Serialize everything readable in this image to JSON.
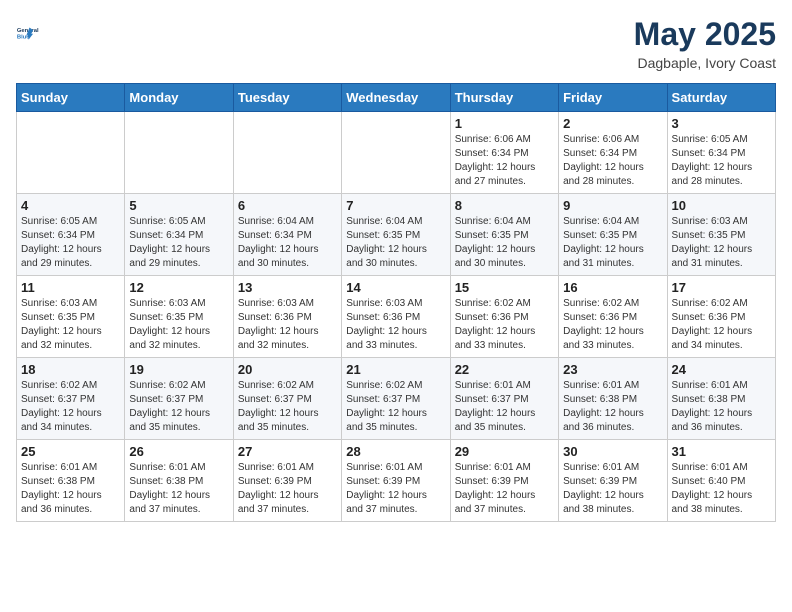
{
  "header": {
    "logo_line1": "General",
    "logo_line2": "Blue",
    "month": "May 2025",
    "location": "Dagbaple, Ivory Coast"
  },
  "weekdays": [
    "Sunday",
    "Monday",
    "Tuesday",
    "Wednesday",
    "Thursday",
    "Friday",
    "Saturday"
  ],
  "weeks": [
    [
      {
        "day": "",
        "info": ""
      },
      {
        "day": "",
        "info": ""
      },
      {
        "day": "",
        "info": ""
      },
      {
        "day": "",
        "info": ""
      },
      {
        "day": "1",
        "info": "Sunrise: 6:06 AM\nSunset: 6:34 PM\nDaylight: 12 hours\nand 27 minutes."
      },
      {
        "day": "2",
        "info": "Sunrise: 6:06 AM\nSunset: 6:34 PM\nDaylight: 12 hours\nand 28 minutes."
      },
      {
        "day": "3",
        "info": "Sunrise: 6:05 AM\nSunset: 6:34 PM\nDaylight: 12 hours\nand 28 minutes."
      }
    ],
    [
      {
        "day": "4",
        "info": "Sunrise: 6:05 AM\nSunset: 6:34 PM\nDaylight: 12 hours\nand 29 minutes."
      },
      {
        "day": "5",
        "info": "Sunrise: 6:05 AM\nSunset: 6:34 PM\nDaylight: 12 hours\nand 29 minutes."
      },
      {
        "day": "6",
        "info": "Sunrise: 6:04 AM\nSunset: 6:34 PM\nDaylight: 12 hours\nand 30 minutes."
      },
      {
        "day": "7",
        "info": "Sunrise: 6:04 AM\nSunset: 6:35 PM\nDaylight: 12 hours\nand 30 minutes."
      },
      {
        "day": "8",
        "info": "Sunrise: 6:04 AM\nSunset: 6:35 PM\nDaylight: 12 hours\nand 30 minutes."
      },
      {
        "day": "9",
        "info": "Sunrise: 6:04 AM\nSunset: 6:35 PM\nDaylight: 12 hours\nand 31 minutes."
      },
      {
        "day": "10",
        "info": "Sunrise: 6:03 AM\nSunset: 6:35 PM\nDaylight: 12 hours\nand 31 minutes."
      }
    ],
    [
      {
        "day": "11",
        "info": "Sunrise: 6:03 AM\nSunset: 6:35 PM\nDaylight: 12 hours\nand 32 minutes."
      },
      {
        "day": "12",
        "info": "Sunrise: 6:03 AM\nSunset: 6:35 PM\nDaylight: 12 hours\nand 32 minutes."
      },
      {
        "day": "13",
        "info": "Sunrise: 6:03 AM\nSunset: 6:36 PM\nDaylight: 12 hours\nand 32 minutes."
      },
      {
        "day": "14",
        "info": "Sunrise: 6:03 AM\nSunset: 6:36 PM\nDaylight: 12 hours\nand 33 minutes."
      },
      {
        "day": "15",
        "info": "Sunrise: 6:02 AM\nSunset: 6:36 PM\nDaylight: 12 hours\nand 33 minutes."
      },
      {
        "day": "16",
        "info": "Sunrise: 6:02 AM\nSunset: 6:36 PM\nDaylight: 12 hours\nand 33 minutes."
      },
      {
        "day": "17",
        "info": "Sunrise: 6:02 AM\nSunset: 6:36 PM\nDaylight: 12 hours\nand 34 minutes."
      }
    ],
    [
      {
        "day": "18",
        "info": "Sunrise: 6:02 AM\nSunset: 6:37 PM\nDaylight: 12 hours\nand 34 minutes."
      },
      {
        "day": "19",
        "info": "Sunrise: 6:02 AM\nSunset: 6:37 PM\nDaylight: 12 hours\nand 35 minutes."
      },
      {
        "day": "20",
        "info": "Sunrise: 6:02 AM\nSunset: 6:37 PM\nDaylight: 12 hours\nand 35 minutes."
      },
      {
        "day": "21",
        "info": "Sunrise: 6:02 AM\nSunset: 6:37 PM\nDaylight: 12 hours\nand 35 minutes."
      },
      {
        "day": "22",
        "info": "Sunrise: 6:01 AM\nSunset: 6:37 PM\nDaylight: 12 hours\nand 35 minutes."
      },
      {
        "day": "23",
        "info": "Sunrise: 6:01 AM\nSunset: 6:38 PM\nDaylight: 12 hours\nand 36 minutes."
      },
      {
        "day": "24",
        "info": "Sunrise: 6:01 AM\nSunset: 6:38 PM\nDaylight: 12 hours\nand 36 minutes."
      }
    ],
    [
      {
        "day": "25",
        "info": "Sunrise: 6:01 AM\nSunset: 6:38 PM\nDaylight: 12 hours\nand 36 minutes."
      },
      {
        "day": "26",
        "info": "Sunrise: 6:01 AM\nSunset: 6:38 PM\nDaylight: 12 hours\nand 37 minutes."
      },
      {
        "day": "27",
        "info": "Sunrise: 6:01 AM\nSunset: 6:39 PM\nDaylight: 12 hours\nand 37 minutes."
      },
      {
        "day": "28",
        "info": "Sunrise: 6:01 AM\nSunset: 6:39 PM\nDaylight: 12 hours\nand 37 minutes."
      },
      {
        "day": "29",
        "info": "Sunrise: 6:01 AM\nSunset: 6:39 PM\nDaylight: 12 hours\nand 37 minutes."
      },
      {
        "day": "30",
        "info": "Sunrise: 6:01 AM\nSunset: 6:39 PM\nDaylight: 12 hours\nand 38 minutes."
      },
      {
        "day": "31",
        "info": "Sunrise: 6:01 AM\nSunset: 6:40 PM\nDaylight: 12 hours\nand 38 minutes."
      }
    ]
  ]
}
